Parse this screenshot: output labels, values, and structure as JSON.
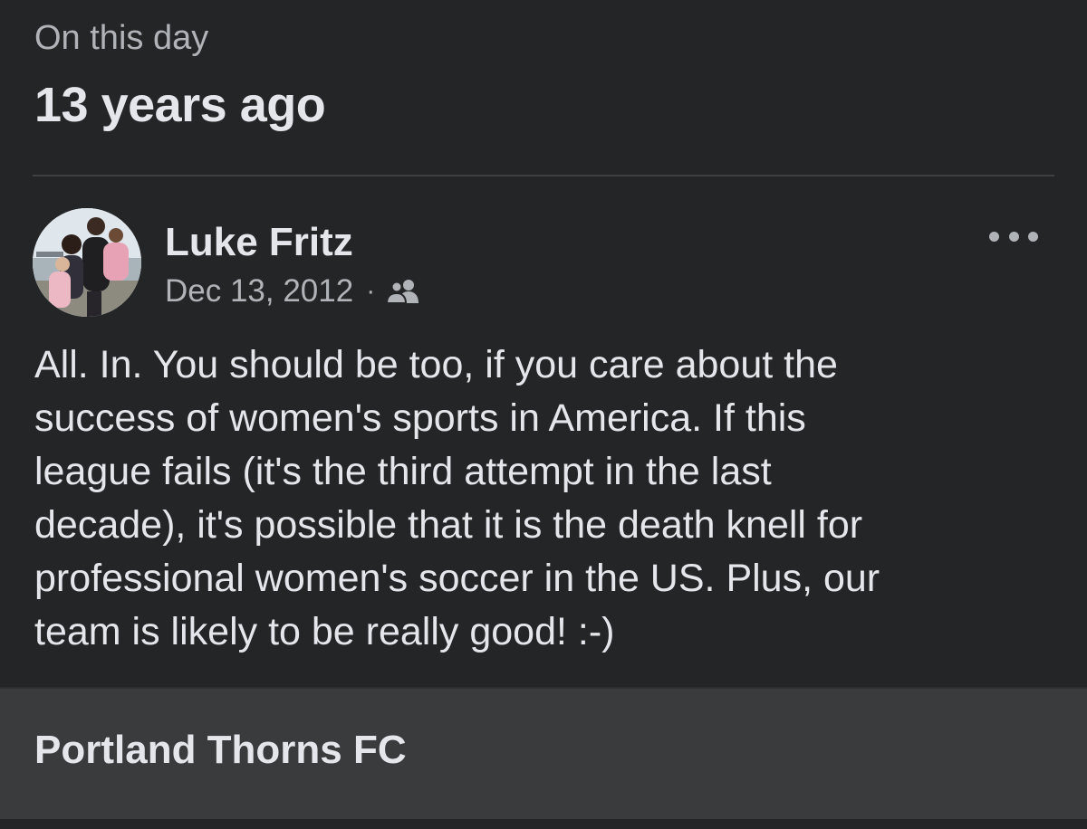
{
  "memory": {
    "subtitle": "On this day",
    "title": "13 years ago"
  },
  "post": {
    "author": "Luke Fritz",
    "avatar_icon": "profile-photo",
    "date": "Dec 13, 2012",
    "separator": "·",
    "audience_icon": "friends-icon",
    "more_icon": "more-options-icon",
    "text_lines": [
      "All. In. You should be too, if you care about the",
      "success of women's sports in America. If this",
      "league fails (it's the third attempt in the last",
      "decade), it's possible that it is the death knell for",
      "professional women's soccer in the US. Plus, our",
      "team is likely to be really good! :-)"
    ]
  },
  "link_preview": {
    "title": "Portland Thorns FC"
  },
  "colors": {
    "background": "#242526",
    "primary_text": "#e4e6eb",
    "secondary_text": "#b0b3b8",
    "card_background": "#3a3b3c",
    "divider": "#3e4042"
  }
}
